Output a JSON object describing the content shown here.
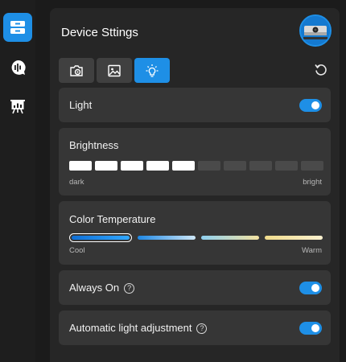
{
  "sidebar": {
    "items": [
      {
        "icon": "device-list-icon",
        "active": true
      },
      {
        "icon": "voice-chat-icon",
        "active": false
      },
      {
        "icon": "presentation-icon",
        "active": false
      }
    ]
  },
  "header": {
    "title": "Device Sttings",
    "avatar_icon": "webcam-avatar-icon"
  },
  "tabs": [
    {
      "icon": "camera-settings-icon",
      "active": false
    },
    {
      "icon": "image-icon",
      "active": false
    },
    {
      "icon": "light-bulb-icon",
      "active": true
    }
  ],
  "light": {
    "label": "Light",
    "enabled": true
  },
  "brightness": {
    "label": "Brightness",
    "level": 5,
    "max": 10,
    "min_label": "dark",
    "max_label": "bright"
  },
  "color_temperature": {
    "label": "Color Temperature",
    "selected_index": 0,
    "min_label": "Cool",
    "max_label": "Warm",
    "options": [
      {
        "colors": [
          "#0f6fd6",
          "#31a8ff"
        ]
      },
      {
        "colors": [
          "#1e88e5",
          "#cfe8f7"
        ]
      },
      {
        "colors": [
          "#8fd0f0",
          "#f3e2a0"
        ]
      },
      {
        "colors": [
          "#f0dc8c",
          "#fbf1cf"
        ]
      }
    ]
  },
  "always_on": {
    "label": "Always On",
    "enabled": true
  },
  "auto_light": {
    "label": "Automatic light adjustment",
    "enabled": true
  },
  "colors": {
    "accent": "#1e8fe6",
    "panel": "#262626",
    "card": "#363636"
  }
}
